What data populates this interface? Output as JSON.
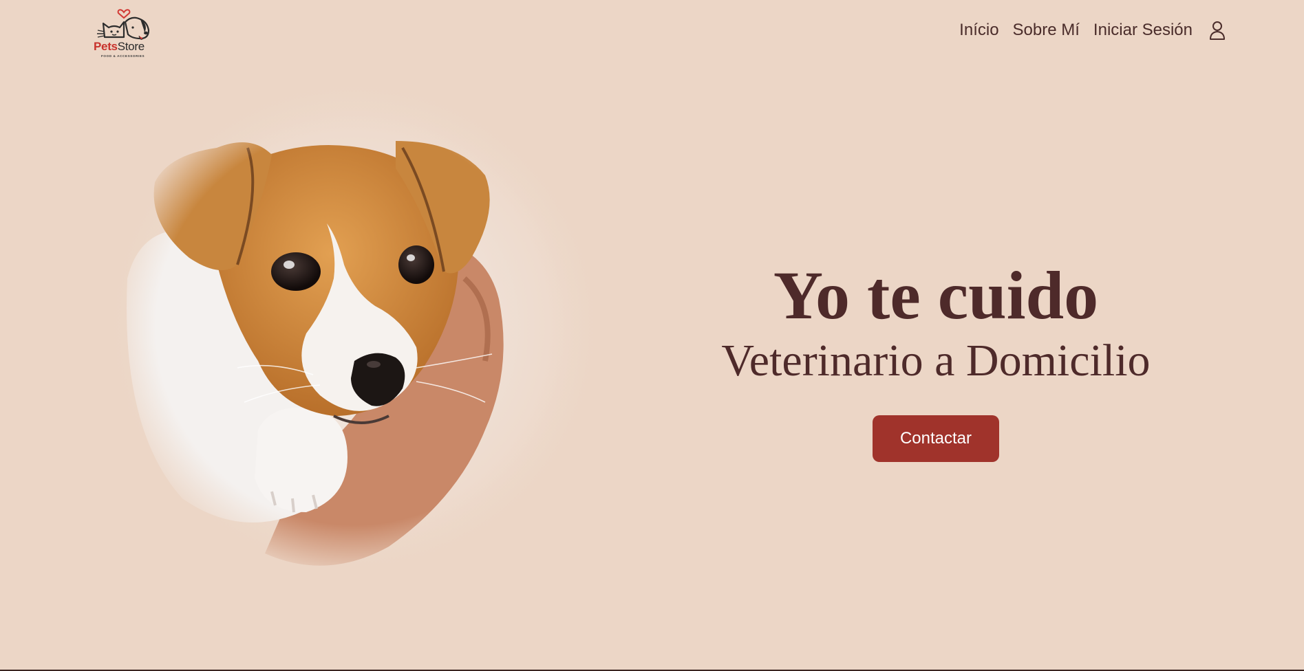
{
  "brand": {
    "name_part1": "Pets",
    "name_part2": "Store",
    "tagline": "FOOD & ACCESSORIES"
  },
  "nav": {
    "items": [
      {
        "label": "Início"
      },
      {
        "label": "Sobre Mí"
      },
      {
        "label": "Iniciar Sesión"
      }
    ],
    "user_icon": "user-icon"
  },
  "hero": {
    "title": "Yo te cuido",
    "subtitle": "Veterinario a Domicilio",
    "cta_label": "Contactar",
    "image_subject": "puppy-photo"
  },
  "colors": {
    "background": "#ecd6c6",
    "text": "#4e2a2a",
    "button": "#a0332b",
    "button_text": "#ffffff",
    "brand_accent": "#c8322c"
  }
}
